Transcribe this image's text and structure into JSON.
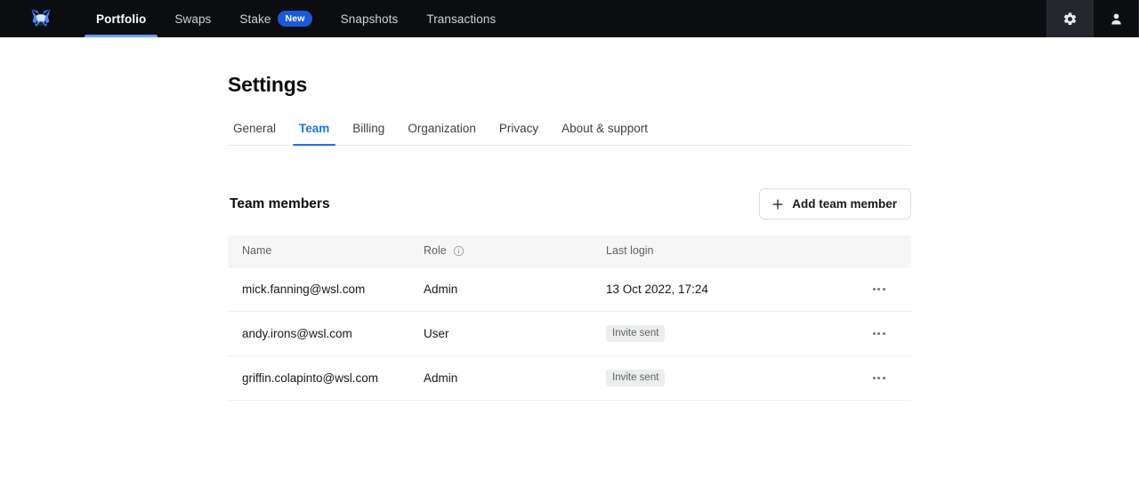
{
  "topnav": {
    "logo_name": "metamask-fox-logo",
    "items": [
      {
        "label": "Portfolio",
        "active": true,
        "badge": null
      },
      {
        "label": "Swaps",
        "active": false,
        "badge": null
      },
      {
        "label": "Stake",
        "active": false,
        "badge": "New"
      },
      {
        "label": "Snapshots",
        "active": false,
        "badge": null
      },
      {
        "label": "Transactions",
        "active": false,
        "badge": null
      }
    ],
    "actions": [
      {
        "icon": "gear-icon",
        "active": true
      },
      {
        "icon": "user-icon",
        "active": false
      }
    ],
    "colors": {
      "background": "#0b0d10",
      "active_underline": "#6b9bf7",
      "badge_background": "#1d58d8",
      "button_active_background": "#24282d"
    }
  },
  "page": {
    "title": "Settings",
    "tabs": [
      {
        "label": "General",
        "active": false
      },
      {
        "label": "Team",
        "active": true
      },
      {
        "label": "Billing",
        "active": false
      },
      {
        "label": "Organization",
        "active": false
      },
      {
        "label": "Privacy",
        "active": false
      },
      {
        "label": "About & support",
        "active": false
      }
    ],
    "accent_color": "#1a73e8"
  },
  "section": {
    "title": "Team members",
    "add_button_label": "Add team member",
    "add_button_icon": "plus-icon"
  },
  "table": {
    "columns": [
      {
        "label": "Name",
        "info_icon": false
      },
      {
        "label": "Role",
        "info_icon": true
      },
      {
        "label": "Last login",
        "info_icon": false
      },
      {
        "label": "",
        "info_icon": false
      }
    ],
    "rows": [
      {
        "name": "mick.fanning@wsl.com",
        "role": "Admin",
        "last_login": "13 Oct 2022, 17:24",
        "last_login_is_badge": false,
        "menu_icon": "overflow-menu-icon"
      },
      {
        "name": "andy.irons@wsl.com",
        "role": "User",
        "last_login": "Invite sent",
        "last_login_is_badge": true,
        "menu_icon": "overflow-menu-icon"
      },
      {
        "name": "griffin.colapinto@wsl.com",
        "role": "Admin",
        "last_login": "Invite sent",
        "last_login_is_badge": true,
        "menu_icon": "overflow-menu-icon"
      }
    ]
  }
}
